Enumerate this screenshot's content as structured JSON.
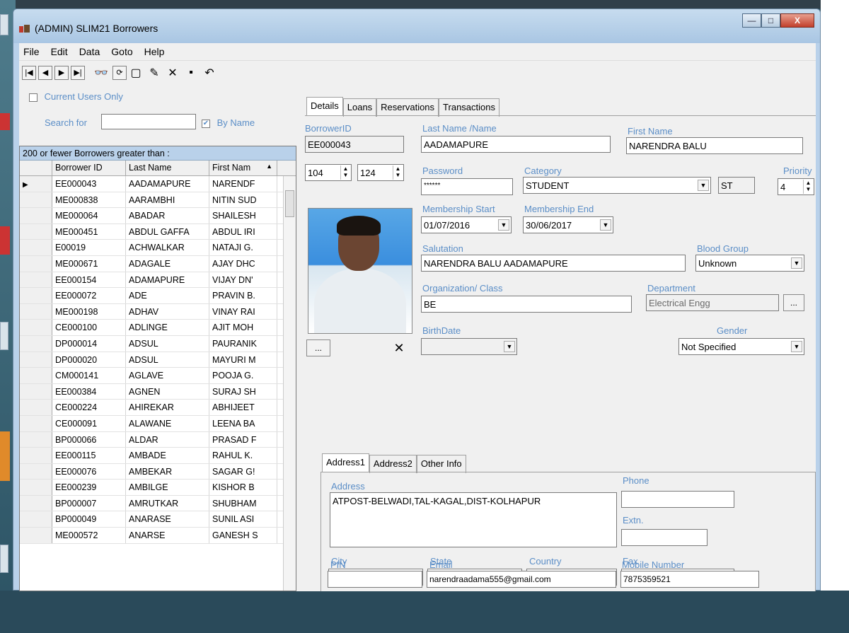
{
  "window": {
    "title": "(ADMIN) SLIM21 Borrowers",
    "minimize": "—",
    "maximize": "□",
    "close": "X"
  },
  "menu": [
    "File",
    "Edit",
    "Data",
    "Goto",
    "Help"
  ],
  "toolbar": {
    "first": "|◀",
    "prev": "◀",
    "next": "▶",
    "last": "▶|",
    "find": "👓",
    "refresh": "⟳",
    "new": "▢",
    "edit": "✎",
    "delete": "✕",
    "save": "▪",
    "undo": "↶"
  },
  "filters": {
    "current_users_label": "Current Users Only",
    "current_users_checked": "",
    "search_label": "Search for",
    "search_value": "",
    "by_name_label": "By Name",
    "by_name_checked": "✔"
  },
  "grid": {
    "caption": "200 or fewer Borrowers greater than :",
    "columns": [
      "Borrower ID",
      "Last Name",
      "First Nam"
    ],
    "sort_indicator": "▲",
    "current_marker": "▶",
    "rows": [
      [
        "EE000043",
        "AADAMAPURE",
        "NARENDF"
      ],
      [
        "ME000838",
        "AARAMBHI",
        "NITIN SUD"
      ],
      [
        "ME000064",
        "ABADAR",
        "SHAILESH"
      ],
      [
        "ME000451",
        "ABDUL GAFFA",
        "ABDUL IRI"
      ],
      [
        "E00019",
        "ACHWALKAR",
        "NATAJI G."
      ],
      [
        "ME000671",
        "ADAGALE",
        "AJAY DHC"
      ],
      [
        "EE000154",
        "ADAMAPURE",
        "VIJAY DN'"
      ],
      [
        "EE000072",
        "ADE",
        "PRAVIN B."
      ],
      [
        "ME000198",
        "ADHAV",
        "VINAY RAI"
      ],
      [
        "CE000100",
        "ADLINGE",
        "AJIT MOH"
      ],
      [
        "DP000014",
        "ADSUL",
        "PAURANIK"
      ],
      [
        "DP000020",
        "ADSUL",
        "MAYURI M"
      ],
      [
        "CM000141",
        "AGLAVE",
        "POOJA G."
      ],
      [
        "EE000384",
        "AGNEN",
        "SURAJ SH"
      ],
      [
        "CE000224",
        "AHIREKAR",
        "ABHIJEET"
      ],
      [
        "CE000091",
        "ALAWANE",
        "LEENA BA"
      ],
      [
        "BP000066",
        "ALDAR",
        "PRASAD F"
      ],
      [
        "EE000115",
        "AMBADE",
        "RAHUL K."
      ],
      [
        "EE000076",
        "AMBEKAR",
        "SAGAR G!"
      ],
      [
        "EE000239",
        "AMBILGE",
        "KISHOR B"
      ],
      [
        "BP000007",
        "AMRUTKAR",
        "SHUBHAM"
      ],
      [
        "BP000049",
        "ANARASE",
        "SUNIL ASI"
      ],
      [
        "ME000572",
        "ANARSE",
        "GANESH S"
      ]
    ]
  },
  "tabs": [
    "Details",
    "Loans",
    "Reservations",
    "Transactions"
  ],
  "details": {
    "borrower_id_label": "BorrowerID",
    "borrower_id": "EE000043",
    "last_name_label": "Last Name /Name",
    "last_name": "AADAMAPURE",
    "first_name_label": "First Name",
    "first_name": "NARENDRA BALU",
    "spin1": "104",
    "spin2": "124",
    "password_label": "Password",
    "password": "******",
    "category_label": "Category",
    "category": "STUDENT",
    "category_code": "ST",
    "priority_label": "Priority",
    "priority": "4",
    "membership_start_label": "Membership Start",
    "membership_start": "01/07/2016",
    "membership_end_label": "Membership End",
    "membership_end": "30/06/2017",
    "salutation_label": "Salutation",
    "salutation": "NARENDRA BALU AADAMAPURE",
    "blood_group_label": "Blood Group",
    "blood_group": "Unknown",
    "organization_label": "Organization/ Class",
    "organization": "BE",
    "department_label": "Department",
    "department": "Electrical Engg",
    "browse_label": "...",
    "photo_browse": "...",
    "photo_clear": "✕",
    "birthdate_label": "BirthDate",
    "birthdate": "",
    "gender_label": "Gender",
    "gender": "Not Specified"
  },
  "address_tabs": [
    "Address1",
    "Address2",
    "Other Info"
  ],
  "address": {
    "address_label": "Address",
    "address": "ATPOST-BELWADI,TAL-KAGAL,DIST-KOLHAPUR",
    "phone_label": "Phone",
    "phone": "",
    "extn_label": "Extn.",
    "extn": "",
    "city_label": "City",
    "city": "",
    "state_label": "State",
    "state": "",
    "country_label": "Country",
    "country": "",
    "fax_label": "Fax",
    "fax": "",
    "pin_label": "PIN",
    "pin": "",
    "email_label": "Email",
    "email": "narendraadama555@gmail.com",
    "mobile_label": "Mobile Number",
    "mobile": "7875359521"
  }
}
